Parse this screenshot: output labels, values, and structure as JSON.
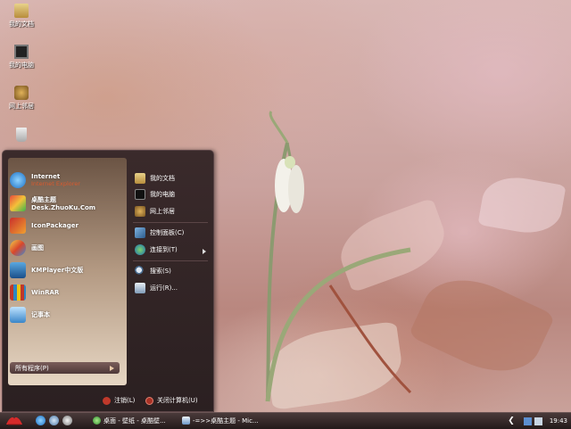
{
  "desktop": {
    "icons": [
      {
        "label": "我的文档",
        "icon": "folder-icon"
      },
      {
        "label": "我的电脑",
        "icon": "computer-icon"
      },
      {
        "label": "网上邻居",
        "icon": "network-icon"
      },
      {
        "label": "",
        "icon": "recycle-bin-icon"
      }
    ]
  },
  "start_menu": {
    "pinned": [
      {
        "title": "Internet",
        "subtitle": "Internet Explorer",
        "icon": "ie-icon"
      },
      {
        "title": "桌酷主题",
        "subtitle": "Desk.ZhuoKu.Com",
        "icon": "zhuoku-icon"
      }
    ],
    "recent": [
      {
        "title": "IconPackager",
        "icon": "iconpackager-icon"
      },
      {
        "title": "画图",
        "icon": "paint-icon"
      },
      {
        "title": "KMPlayer中文版",
        "icon": "kmplayer-icon"
      },
      {
        "title": "WinRAR",
        "icon": "winrar-icon"
      },
      {
        "title": "记事本",
        "icon": "notepad-icon"
      }
    ],
    "all_programs": "所有程序(P)",
    "places": [
      {
        "label": "我的文档",
        "icon": "folder-icon"
      },
      {
        "label": "我的电脑",
        "icon": "computer-icon"
      },
      {
        "label": "网上邻居",
        "icon": "network-icon"
      }
    ],
    "system": [
      {
        "label": "控制面板(C)",
        "icon": "control-panel-icon"
      },
      {
        "label": "连接到(T)",
        "icon": "connect-icon"
      }
    ],
    "tools": [
      {
        "label": "搜索(S)",
        "icon": "search-icon"
      },
      {
        "label": "运行(R)...",
        "icon": "run-icon"
      }
    ],
    "logoff": "注销(L)",
    "shutdown": "关闭计算机(U)"
  },
  "taskbar": {
    "tasks": [
      {
        "label": "桌面 - 壁纸 - 桌酷壁...",
        "icon": "browser-icon"
      },
      {
        "label": "-=>>桌酷主题 - Mic...",
        "icon": "document-icon"
      }
    ],
    "clock": "19:43"
  },
  "colors": {
    "menu_bg": "#2b2021",
    "accent": "#d85a2e",
    "taskbar": "#231a1a"
  }
}
